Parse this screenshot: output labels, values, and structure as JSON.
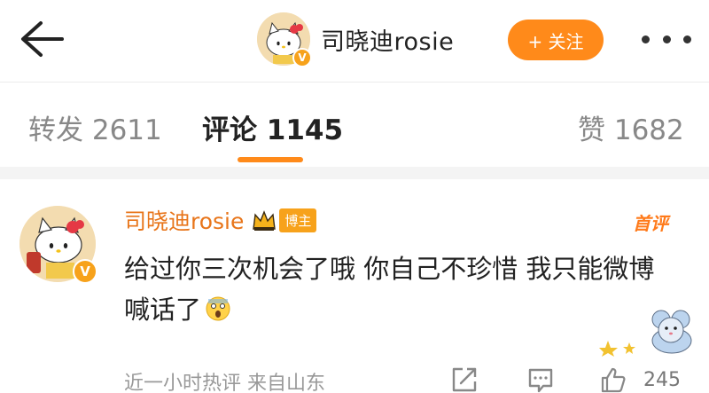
{
  "header": {
    "back_icon": "arrow-left-icon",
    "username": "司晓迪rosie",
    "verified_badge": "V",
    "follow_label": "+ 关注",
    "more_icon": "more-dots-icon",
    "accent_color": "#ff8a1a"
  },
  "tabs": [
    {
      "label": "转发 2611",
      "active": false
    },
    {
      "label": "评论 1145",
      "active": true
    },
    {
      "label": "赞 1682",
      "active": false
    }
  ],
  "comment": {
    "username": "司晓迪rosie",
    "verified_badge": "V",
    "author_tag": "博主",
    "top_tag": "首评",
    "text": "给过你三次机会了哦 你自己不珍惜 我只能微博喊话了",
    "emoji": "scared-face-emoji",
    "meta": "近一小时热评 来自山东",
    "like_count": "245",
    "name_color": "#e8751a"
  }
}
